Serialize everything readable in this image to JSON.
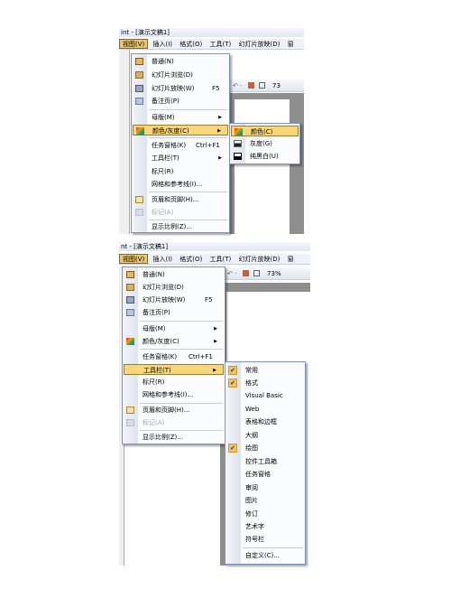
{
  "title": "int - [演示文稿1]",
  "title2": "nt - [演示文稿1]",
  "menubar": [
    "视图(V)",
    "插入(I)",
    "格式(O)",
    "工具(T)",
    "幻灯片放映(D)",
    "窗"
  ],
  "zoom1": "73",
  "zoom2": "73%",
  "view_menu": {
    "normal": "普通(N)",
    "sorter": "幻灯片浏览(D)",
    "show": "幻灯片放映(W)",
    "show_sc": "F5",
    "notes": "备注页(P)",
    "master": "母版(M)",
    "color": "颜色/灰度(C)",
    "taskpane": "任务窗格(K)",
    "taskpane_sc": "Ctrl+F1",
    "toolbars": "工具栏(T)",
    "ruler": "标尺(R)",
    "grid": "网格和参考线(I)...",
    "header": "页眉和页脚(H)...",
    "markup": "标记(A)",
    "zoom": "显示比例(Z)..."
  },
  "color_submenu": [
    "颜色(C)",
    "灰度(G)",
    "纯黑白(U)"
  ],
  "toolbar_submenu": [
    {
      "label": "常用",
      "checked": true
    },
    {
      "label": "格式",
      "checked": true
    },
    {
      "label": "Visual Basic",
      "checked": false
    },
    {
      "label": "Web",
      "checked": false
    },
    {
      "label": "表格和边框",
      "checked": false
    },
    {
      "label": "大纲",
      "checked": false
    },
    {
      "label": "绘图",
      "checked": true
    },
    {
      "label": "控件工具箱",
      "checked": false
    },
    {
      "label": "任务窗格",
      "checked": false
    },
    {
      "label": "审阅",
      "checked": false
    },
    {
      "label": "图片",
      "checked": false
    },
    {
      "label": "修订",
      "checked": false
    },
    {
      "label": "艺术字",
      "checked": false
    },
    {
      "label": "符号栏",
      "checked": false
    },
    {
      "label": "自定义(C)...",
      "checked": false
    }
  ]
}
